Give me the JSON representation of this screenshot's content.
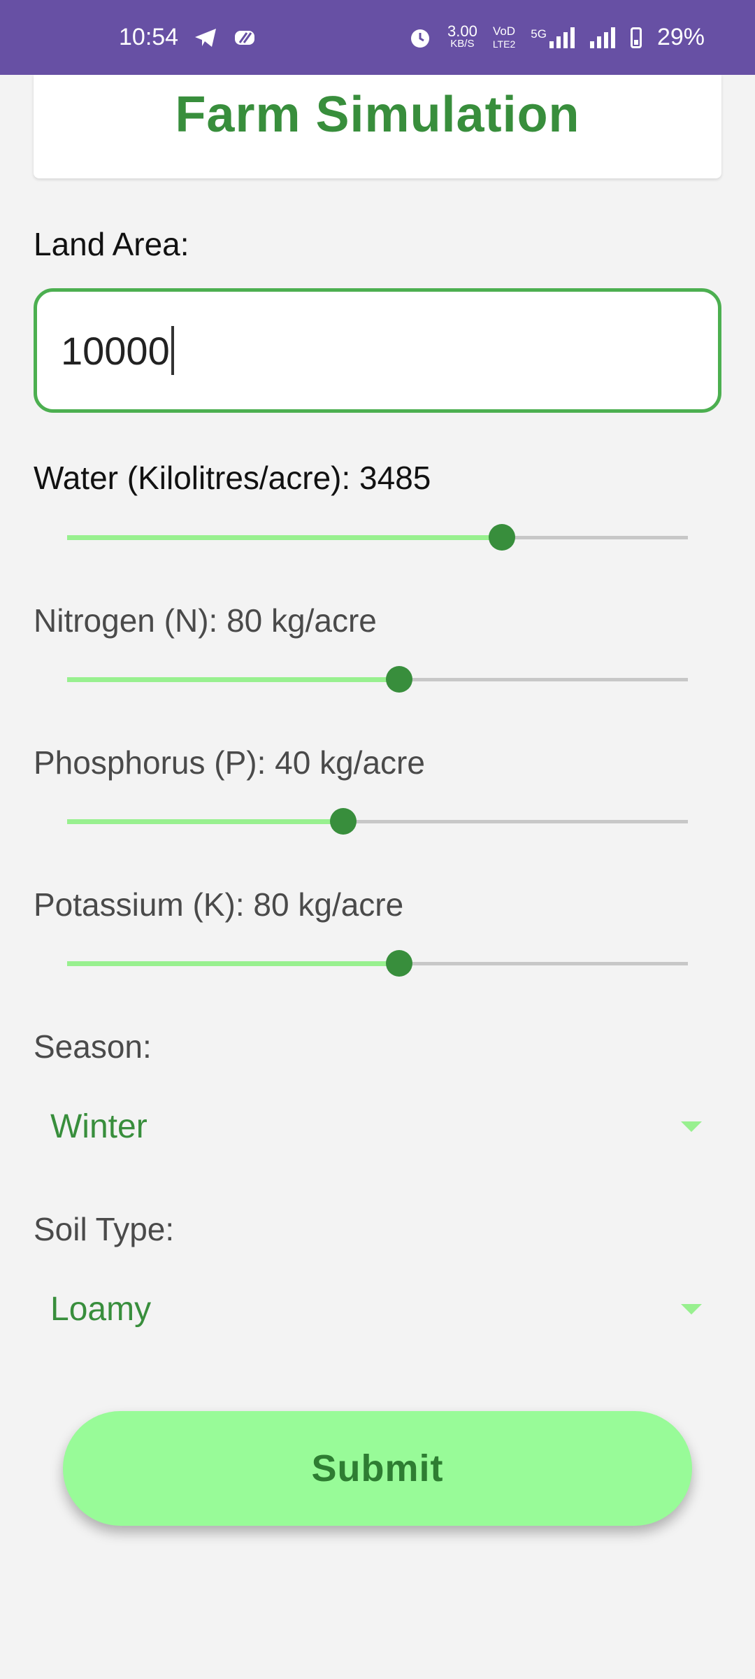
{
  "status": {
    "time": "10:54",
    "speed_value": "3.00",
    "speed_unit": "KB/S",
    "volte_top": "VoD",
    "volte_bottom": "LTE2",
    "net": "5G",
    "battery": "29%"
  },
  "header": {
    "title": "Farm Simulation"
  },
  "form": {
    "land_area": {
      "label": "Land Area:",
      "value": "10000"
    },
    "water": {
      "label": "Water (Kilolitres/acre): 3485",
      "level": 0.7
    },
    "nitrogen": {
      "label": "Nitrogen (N): 80 kg/acre",
      "level": 0.535
    },
    "phosphorus": {
      "label": "Phosphorus (P): 40 kg/acre",
      "level": 0.445
    },
    "potassium": {
      "label": "Potassium (K): 80 kg/acre",
      "level": 0.535
    },
    "season": {
      "label": "Season:",
      "value": "Winter"
    },
    "soil": {
      "label": "Soil Type:",
      "value": "Loamy"
    },
    "submit_label": "Submit"
  },
  "colors": {
    "status_bar": "#6750a4",
    "accent_green": "#388e3c",
    "light_green": "#98fb98"
  }
}
